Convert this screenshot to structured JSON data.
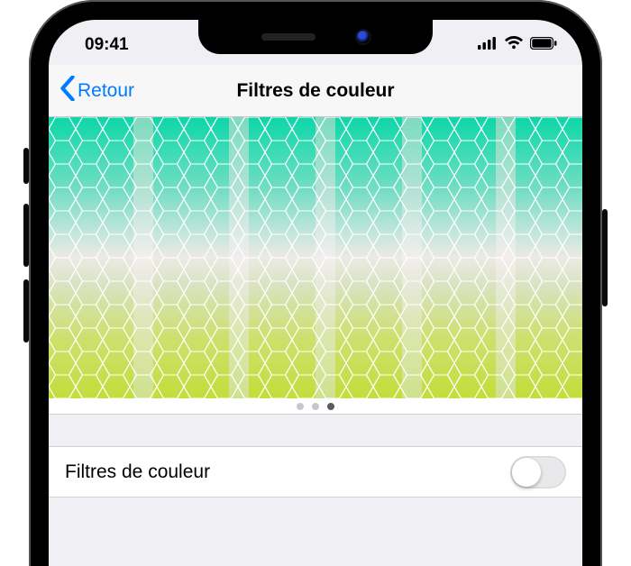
{
  "status": {
    "time": "09:41"
  },
  "nav": {
    "back_label": "Retour",
    "title": "Filtres de couleur"
  },
  "pager": {
    "count": 3,
    "active_index": 2
  },
  "settings": {
    "color_filters": {
      "label": "Filtres de couleur",
      "value": false
    }
  },
  "colors": {
    "accent": "#007aff"
  }
}
